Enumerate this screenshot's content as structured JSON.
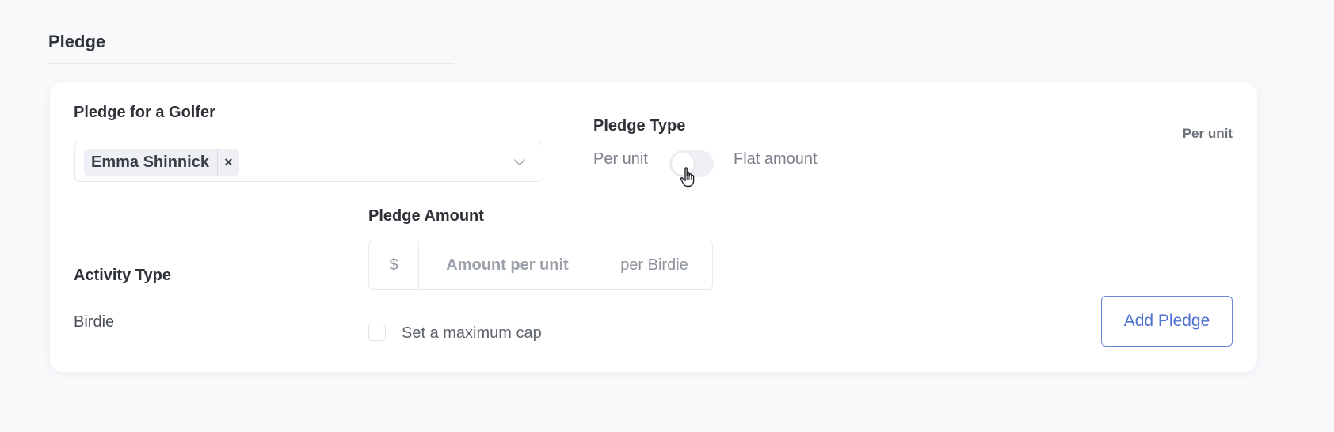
{
  "section": {
    "title": "Pledge"
  },
  "golfer": {
    "label": "Pledge for a Golfer",
    "selected": "Emma Shinnick",
    "remove_glyph": "×"
  },
  "pledge_type": {
    "label": "Pledge Type",
    "option_left": "Per unit",
    "option_right": "Flat amount",
    "current": "Per unit"
  },
  "pledge_amount": {
    "label": "Pledge Amount",
    "prefix": "$",
    "placeholder": "Amount per unit",
    "suffix": "per Birdie"
  },
  "activity": {
    "label": "Activity Type",
    "value": "Birdie"
  },
  "cap": {
    "label": "Set a maximum cap"
  },
  "actions": {
    "add_label": "Add Pledge"
  },
  "colors": {
    "accent": "#4d6fd0",
    "background": "#f8f9fb",
    "card": "#ffffff"
  },
  "icons": {
    "chevron": "chevron-down-icon",
    "cursor": "hand-pointer-icon",
    "remove": "close-icon"
  }
}
